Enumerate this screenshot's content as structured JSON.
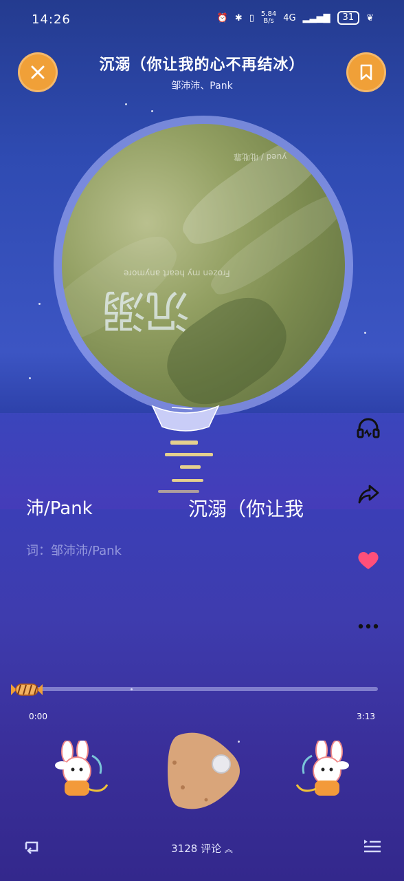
{
  "status_bar": {
    "time": "14:26",
    "net_speed_top": "5.84",
    "net_speed_unit": "B/s",
    "network": "4G",
    "battery": "31"
  },
  "header": {
    "title": "沉溺（你让我的心不再结冰）",
    "artists": "邹沛沛、Pank"
  },
  "album": {
    "cover_text_1": "yued / 吡吡靠",
    "cover_text_2": "Frozen my heart anymore",
    "cover_glyph": "沉溺"
  },
  "lyrics": {
    "line_left": "沛/Pank",
    "line_right": "沉溺（你让我",
    "credit": "词：邹沛沛/Pank"
  },
  "side_actions": [
    "headphones-icon",
    "share-icon",
    "heart-icon",
    "more-icon"
  ],
  "progress": {
    "current": "0:00",
    "total": "3:13",
    "fraction": 0.01
  },
  "footer": {
    "comments_count": "3128",
    "comments_label": "评论"
  },
  "colors": {
    "accent_orange": "#f0a038",
    "heart_pink": "#ff4f7a"
  }
}
